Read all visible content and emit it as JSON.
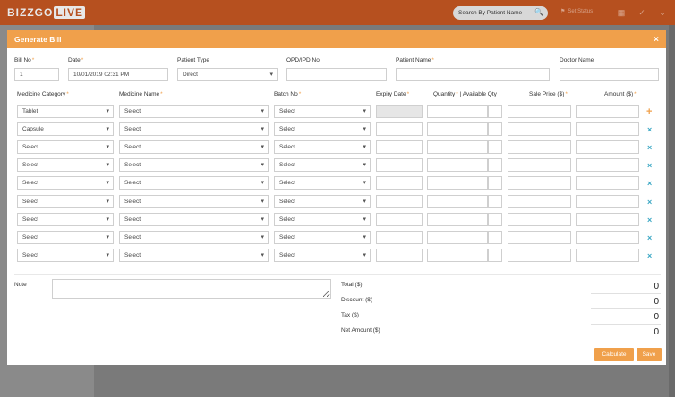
{
  "topbar": {
    "logo_left": "BIZZGO",
    "logo_right": "LIVE",
    "search_placeholder": "Search By Patient Name",
    "user_label": "Set Status"
  },
  "modal": {
    "title": "Generate Bill",
    "close": "×"
  },
  "header_fields": {
    "bill_no": {
      "label": "Bill No",
      "value": "1"
    },
    "date": {
      "label": "Date",
      "value": "10/01/2019 02:31 PM"
    },
    "patient_type": {
      "label": "Patient Type",
      "value": "Direct"
    },
    "opd_ipd": {
      "label": "OPD/IPD No",
      "value": ""
    },
    "patient_name": {
      "label": "Patient Name",
      "value": ""
    },
    "doctor_name": {
      "label": "Doctor Name",
      "value": ""
    }
  },
  "columns": {
    "medicine_category": "Medicine Category",
    "medicine_name": "Medicine Name",
    "batch_no": "Batch No",
    "expiry_date": "Expiry Date",
    "quantity": "Quantity",
    "available_qty": "| Available Qty",
    "sale_price": "Sale Price ($)",
    "amount": "Amount ($)"
  },
  "rows": [
    {
      "category": "Tablet",
      "name": "Select",
      "batch": "Select",
      "action": "+"
    },
    {
      "category": "Capsule",
      "name": "Select",
      "batch": "Select",
      "action": "×"
    },
    {
      "category": "Select",
      "name": "Select",
      "batch": "Select",
      "action": "×"
    },
    {
      "category": "Select",
      "name": "Select",
      "batch": "Select",
      "action": "×"
    },
    {
      "category": "Select",
      "name": "Select",
      "batch": "Select",
      "action": "×"
    },
    {
      "category": "Select",
      "name": "Select",
      "batch": "Select",
      "action": "×"
    },
    {
      "category": "Select",
      "name": "Select",
      "batch": "Select",
      "action": "×"
    },
    {
      "category": "Select",
      "name": "Select",
      "batch": "Select",
      "action": "×"
    },
    {
      "category": "Select",
      "name": "Select",
      "batch": "Select",
      "action": "×"
    }
  ],
  "note": {
    "label": "Note",
    "value": ""
  },
  "totals": {
    "total": {
      "label": "Total ($)",
      "value": "0"
    },
    "discount": {
      "label": "Discount ($)",
      "value": "0"
    },
    "tax": {
      "label": "Tax ($)",
      "value": "0"
    },
    "net": {
      "label": "Net Amount ($)",
      "value": "0"
    }
  },
  "buttons": {
    "calculate": "Calculate",
    "save": "Save"
  },
  "colors": {
    "accent": "#f0a04b",
    "header_bar": "#b6501f",
    "delete_icon": "#3aa7c4"
  }
}
